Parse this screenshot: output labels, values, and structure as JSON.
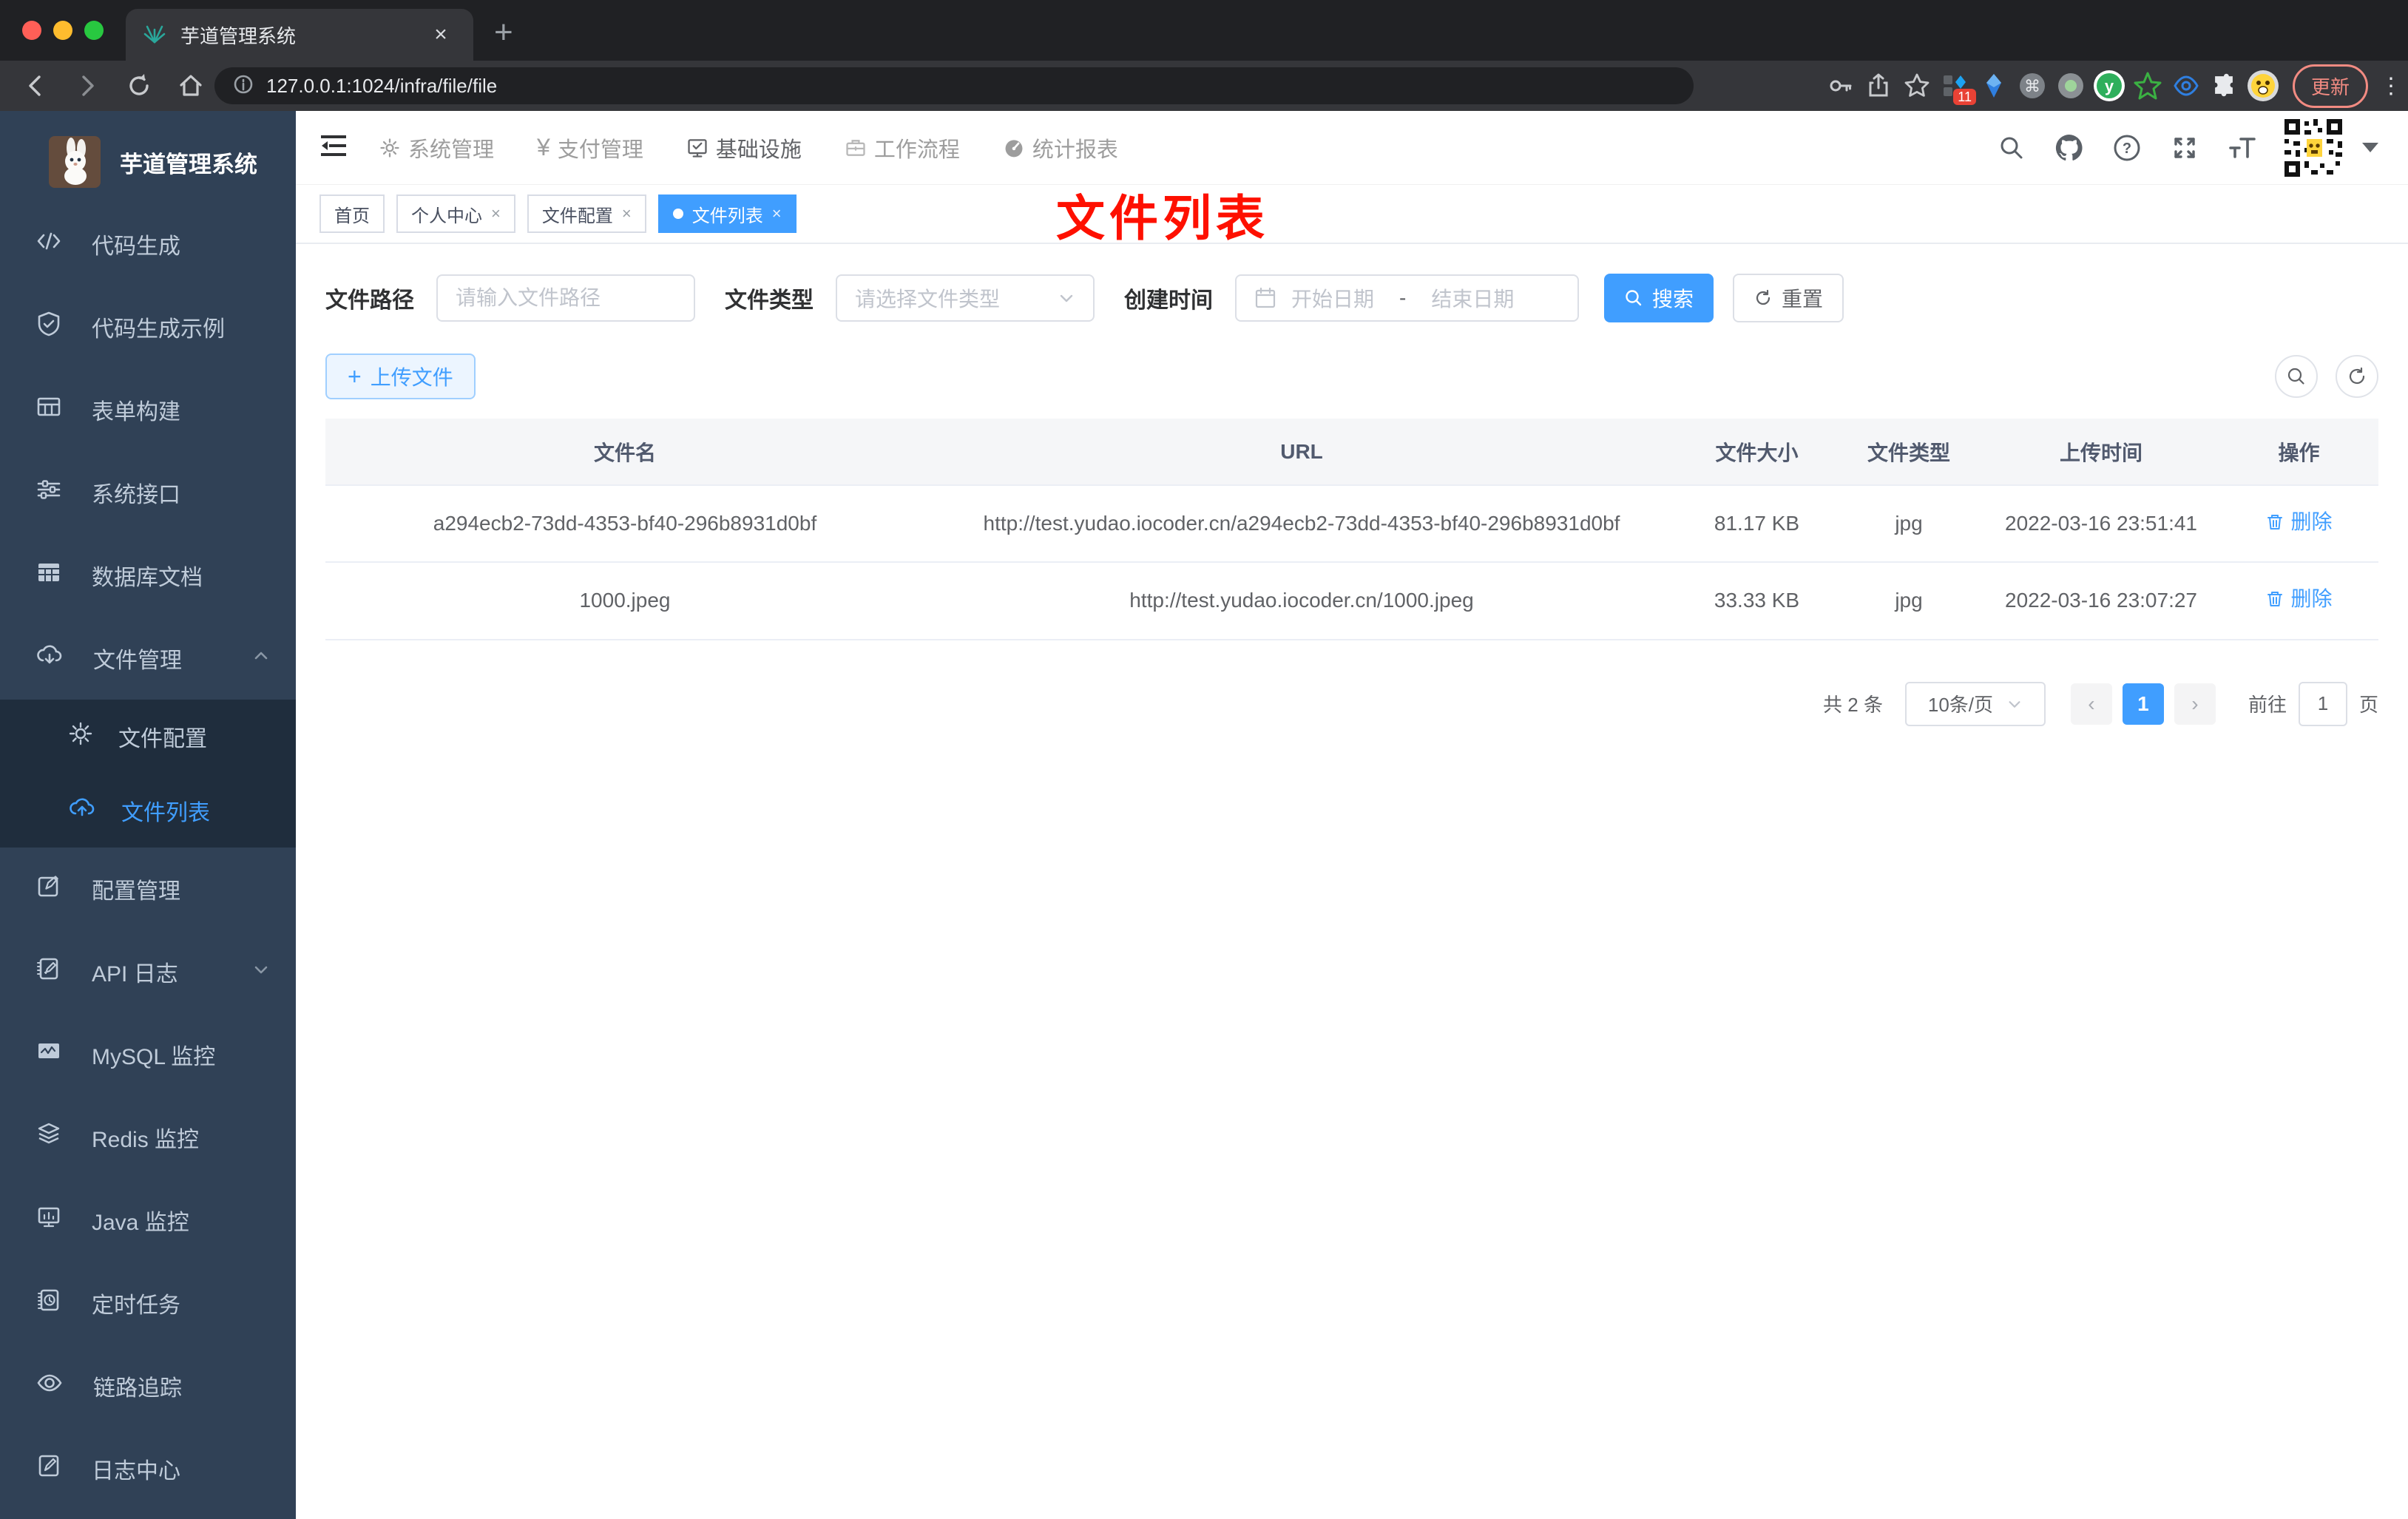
{
  "browser": {
    "tab_title": "芋道管理系统",
    "close_glyph": "×",
    "newtab_glyph": "+",
    "url": "127.0.0.1:1024/infra/file/file",
    "ext_badge": "11",
    "command_glyph": "⌘",
    "update_label": "更新",
    "kebab_glyph": "⋮"
  },
  "sidebar": {
    "title": "芋道管理系统",
    "items": [
      {
        "label": "代码生成"
      },
      {
        "label": "代码生成示例"
      },
      {
        "label": "表单构建"
      },
      {
        "label": "系统接口"
      },
      {
        "label": "数据库文档"
      },
      {
        "label": "文件管理"
      },
      {
        "label": "文件配置"
      },
      {
        "label": "文件列表"
      },
      {
        "label": "配置管理"
      },
      {
        "label": "API 日志"
      },
      {
        "label": "MySQL 监控"
      },
      {
        "label": "Redis 监控"
      },
      {
        "label": "Java 监控"
      },
      {
        "label": "定时任务"
      },
      {
        "label": "链路追踪"
      },
      {
        "label": "日志中心"
      }
    ]
  },
  "topnav": {
    "yen_glyph": "¥",
    "items": [
      {
        "label": "系统管理"
      },
      {
        "label": "支付管理"
      },
      {
        "label": "基础设施"
      },
      {
        "label": "工作流程"
      },
      {
        "label": "统计报表"
      }
    ]
  },
  "tags": [
    {
      "label": "首页"
    },
    {
      "label": "个人中心"
    },
    {
      "label": "文件配置"
    },
    {
      "label": "文件列表"
    }
  ],
  "tag_close_glyph": "×",
  "annotation": "文件列表",
  "filters": {
    "path_label": "文件路径",
    "path_placeholder": "请输入文件路径",
    "type_label": "文件类型",
    "type_placeholder": "请选择文件类型",
    "date_label": "创建时间",
    "date_start": "开始日期",
    "date_separator": "-",
    "date_end": "结束日期",
    "search_label": "搜索",
    "reset_label": "重置"
  },
  "toolbar": {
    "upload_label": "上传文件",
    "plus_glyph": "+"
  },
  "table": {
    "columns": [
      "文件名",
      "URL",
      "文件大小",
      "文件类型",
      "上传时间",
      "操作"
    ],
    "rows": [
      {
        "name": "a294ecb2-73dd-4353-bf40-296b8931d0bf",
        "url": "http://test.yudao.iocoder.cn/a294ecb2-73dd-4353-bf40-296b8931d0bf",
        "size": "81.17 KB",
        "type": "jpg",
        "time": "2022-03-16 23:51:41",
        "action": "删除"
      },
      {
        "name": "1000.jpeg",
        "url": "http://test.yudao.iocoder.cn/1000.jpeg",
        "size": "33.33 KB",
        "type": "jpg",
        "time": "2022-03-16 23:07:27",
        "action": "删除"
      }
    ]
  },
  "pagination": {
    "total": "共 2 条",
    "page_size": "10条/页",
    "prev_glyph": "‹",
    "current_page": "1",
    "next_glyph": "›",
    "goto_label": "前往",
    "goto_value": "1",
    "page_suffix": "页"
  },
  "colors": {
    "accent": "#409eff",
    "sidebar_bg": "#304156",
    "submenu_bg": "#1f2d3d",
    "annotation_red": "#fe1000",
    "tag_active": "#409eff",
    "update_pill": "#f28b82"
  }
}
